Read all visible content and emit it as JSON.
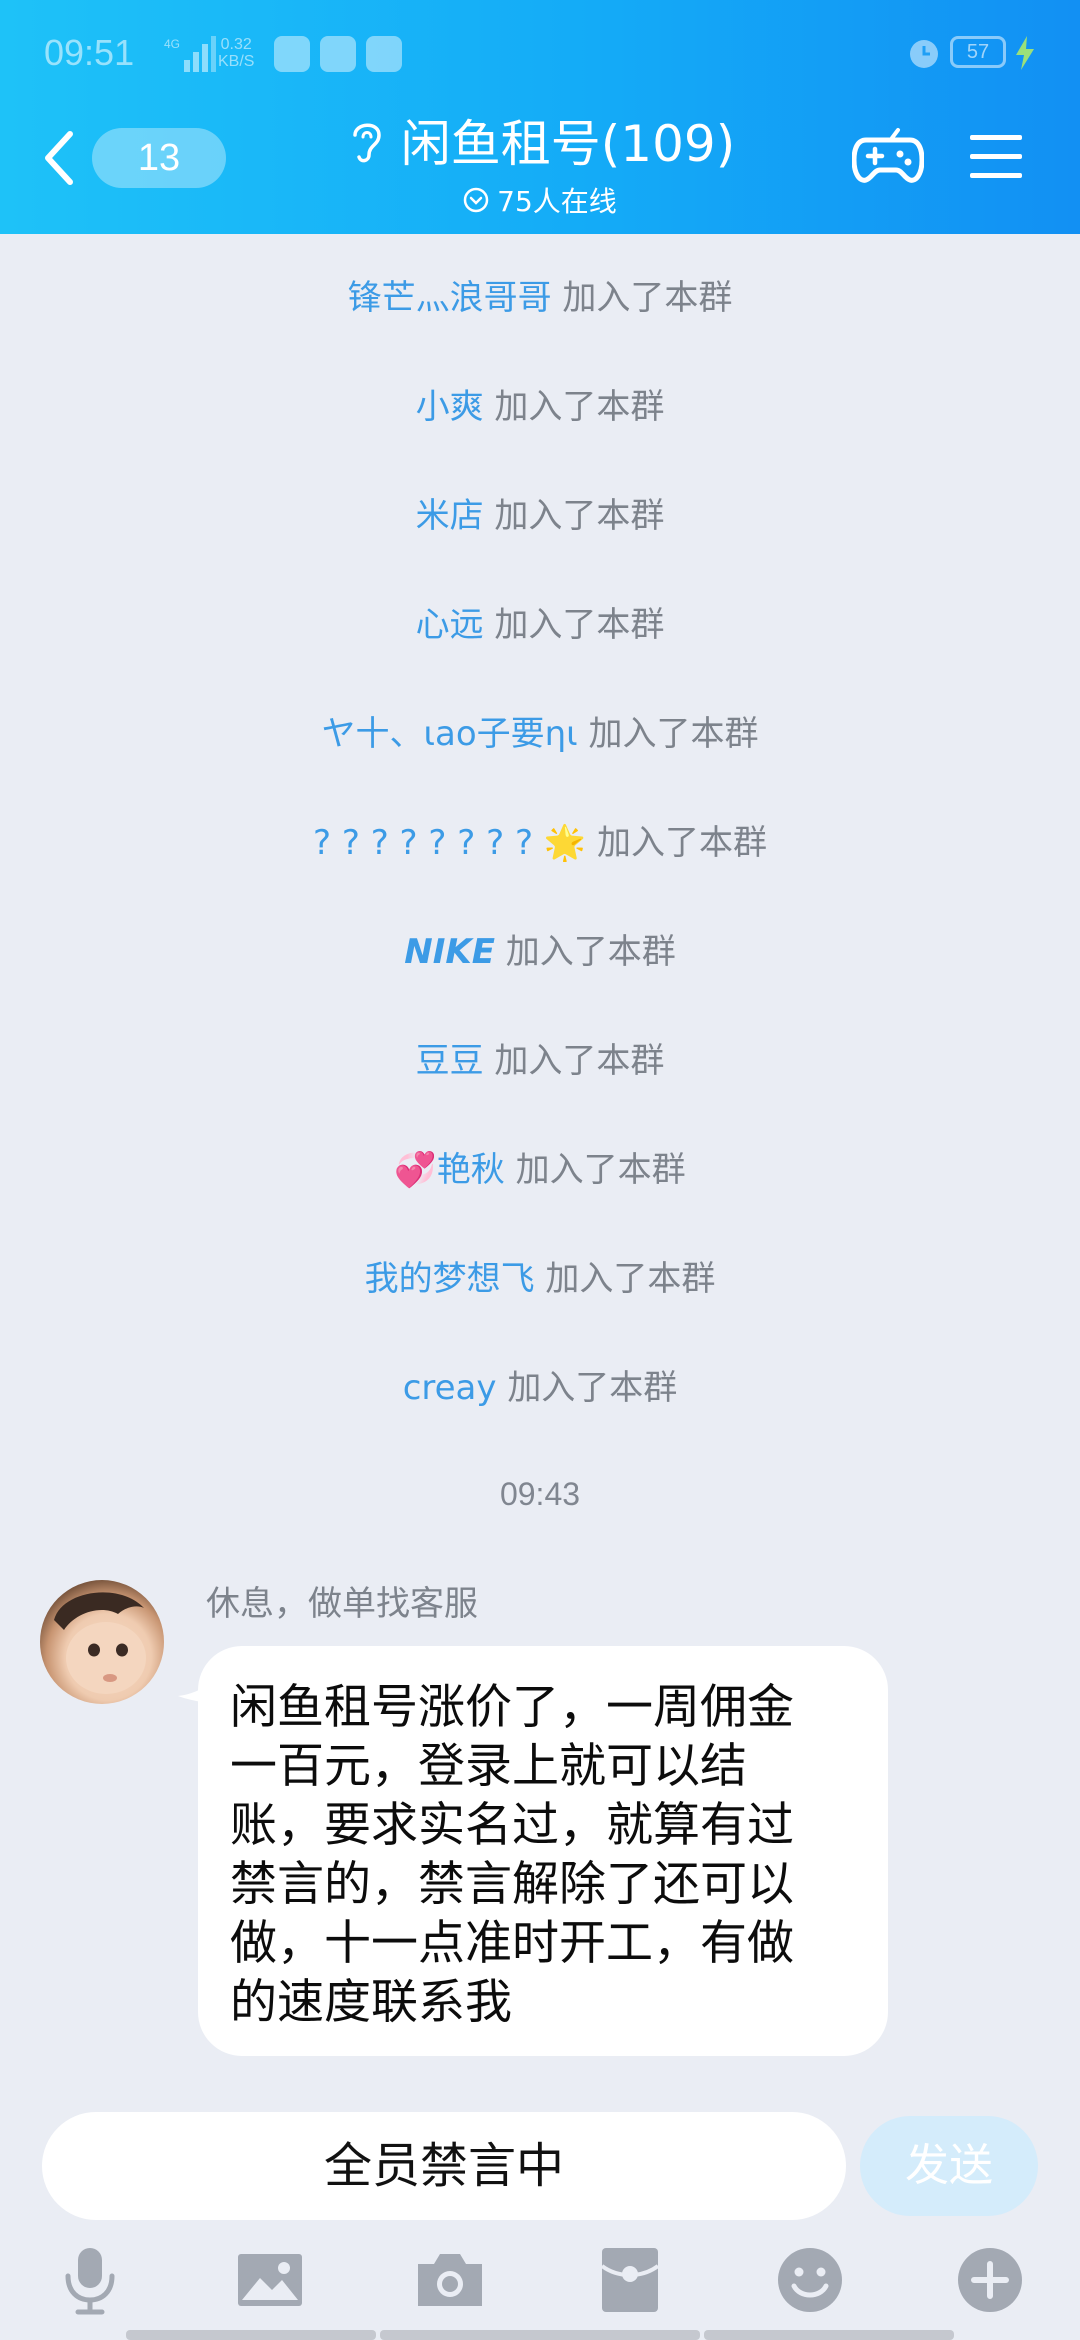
{
  "status_bar": {
    "time": "09:51",
    "net_speed_value": "0.32",
    "net_speed_unit": "KB/S",
    "network_type": "4G",
    "battery": "57"
  },
  "header": {
    "unread_count": "13",
    "title": "闲鱼租号(109)",
    "online": "75人在线"
  },
  "system_messages": [
    {
      "name": "锋芒灬浪哥哥",
      "text": "加入了本群"
    },
    {
      "name": "小爽",
      "text": "加入了本群"
    },
    {
      "name": "米店",
      "text": "加入了本群"
    },
    {
      "name": "心远",
      "text": "加入了本群"
    },
    {
      "name": "ヤ十、ιao子要ηι",
      "text": "加入了本群"
    },
    {
      "name": "? ? ? ? ? ? ? ? 🌟",
      "text": "加入了本群"
    },
    {
      "name": "NIKE",
      "text": "加入了本群"
    },
    {
      "name": "豆豆",
      "text": "加入了本群"
    },
    {
      "name": "💞艳秋",
      "text": "加入了本群"
    },
    {
      "name": "我的梦想飞",
      "text": "加入了本群"
    },
    {
      "name": "creay",
      "text": "加入了本群"
    }
  ],
  "time_separator": "09:43",
  "message": {
    "sender": "休息，做单找客服",
    "lines": [
      "闲鱼租号涨价了，一周佣金",
      "一百元，登录上就可以结",
      "账，要求实名过，就算有过",
      "禁言的，禁言解除了还可以",
      "做，十一点准时开工，有做",
      "的速度联系我"
    ]
  },
  "input": {
    "placeholder": "全员禁言中",
    "send_label": "发送"
  },
  "toolbar": [
    "mic-icon",
    "image-icon",
    "camera-icon",
    "red-packet-icon",
    "emoji-icon",
    "plus-icon"
  ],
  "colors": {
    "header_start": "#1ec2f8",
    "header_end": "#1290f3",
    "chat_bg": "#eaedf4",
    "name_link": "#3c9be6",
    "system_text": "#7d838c",
    "send_disabled": "#d4ecfb",
    "toolbar_icon": "#a3a9b3"
  }
}
